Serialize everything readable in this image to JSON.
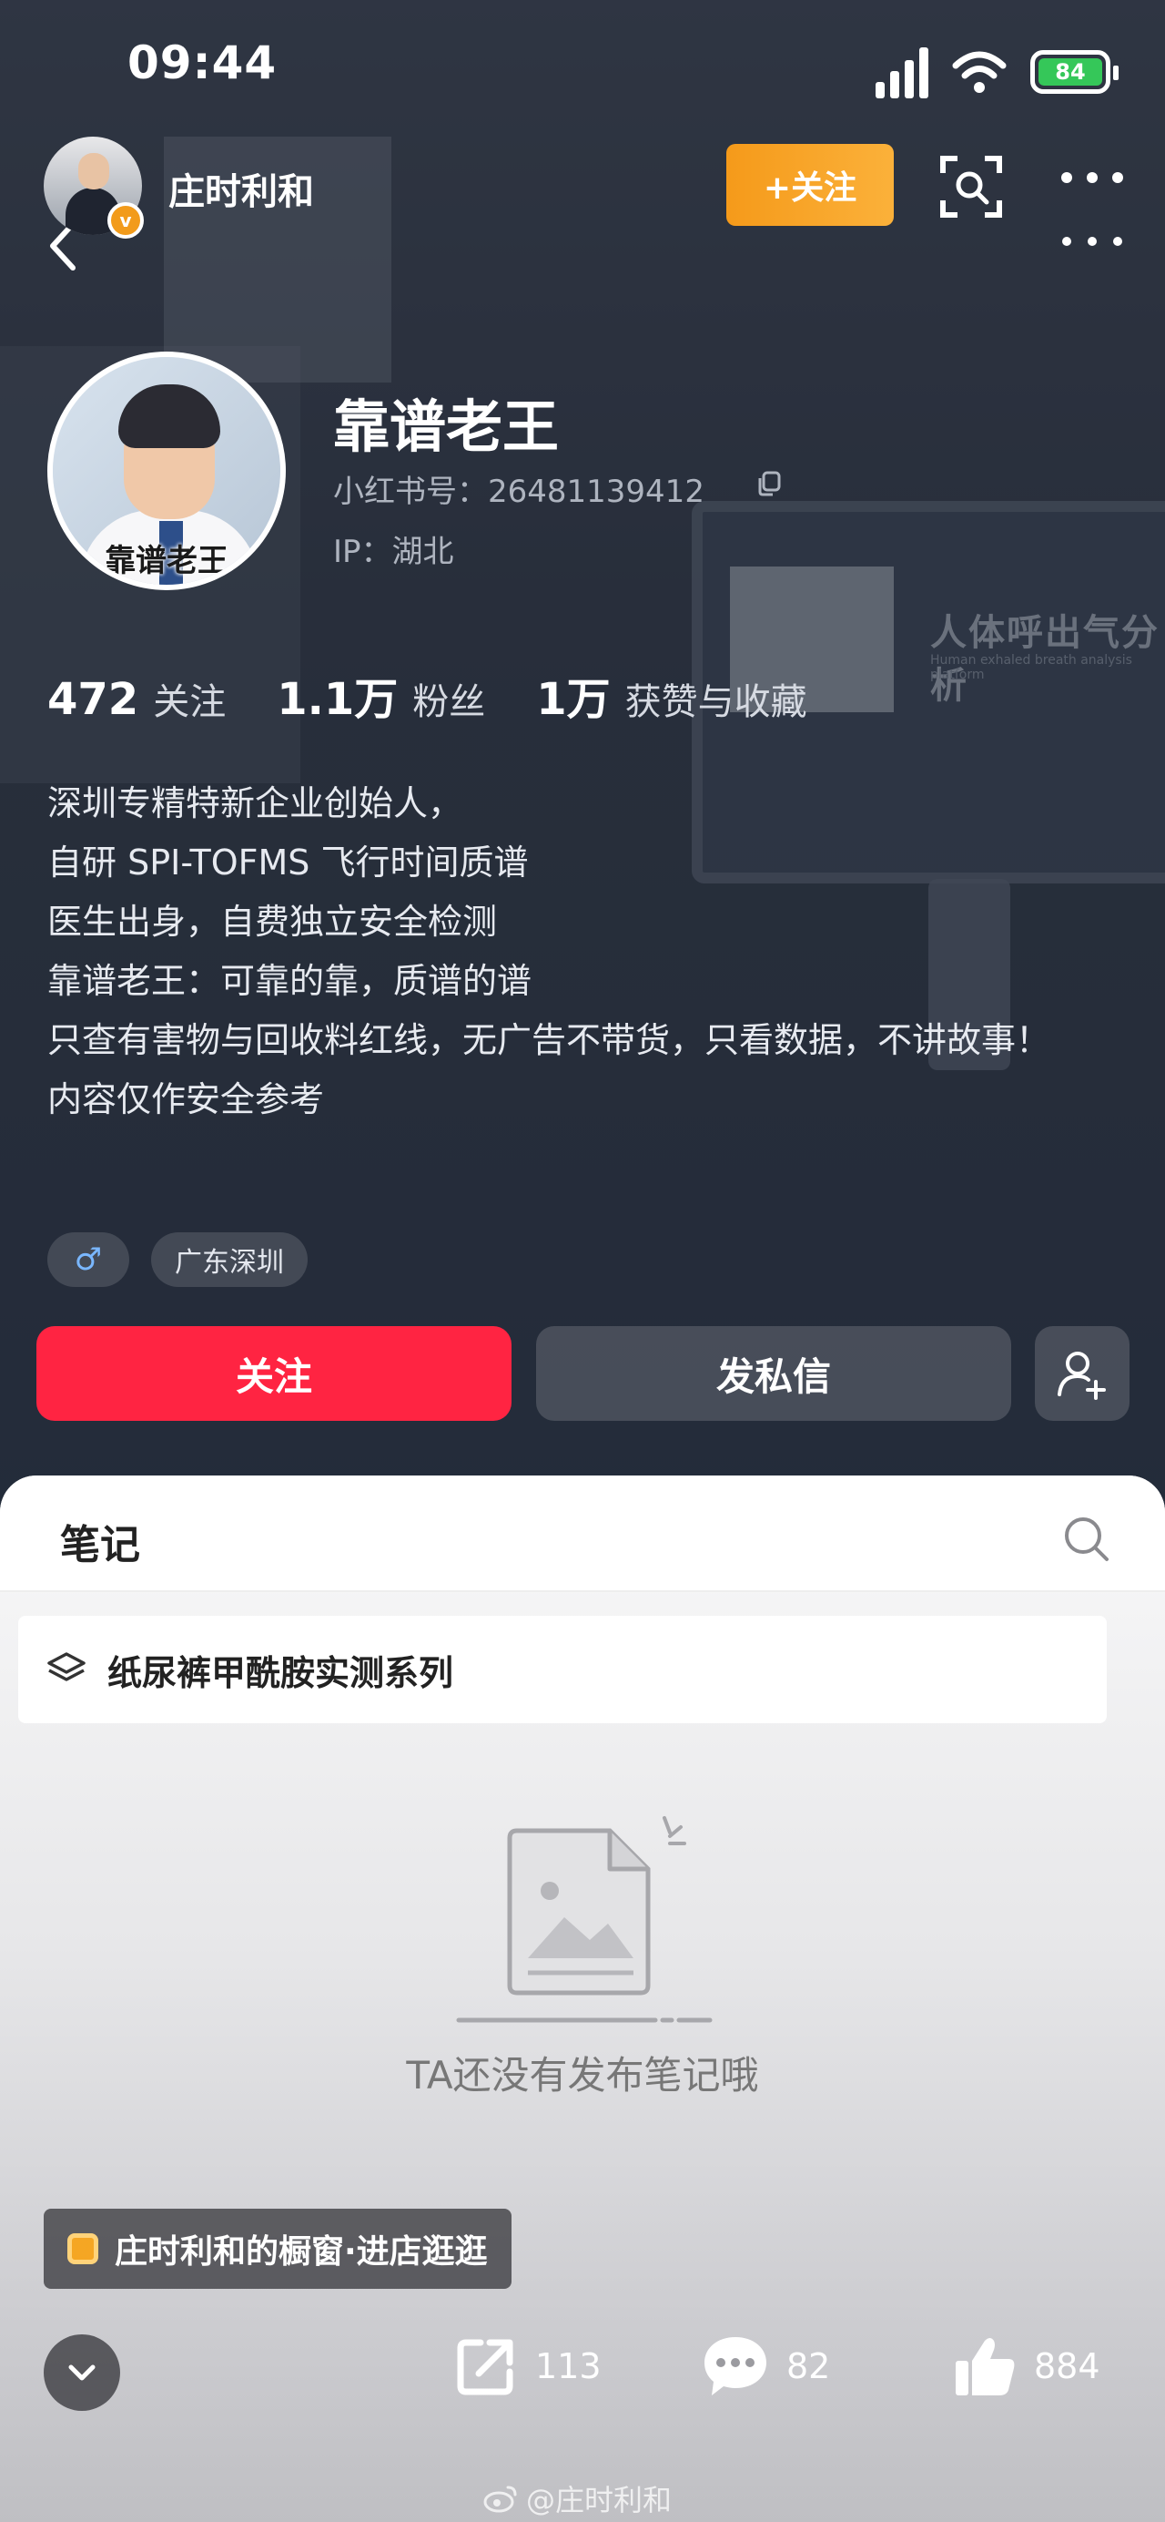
{
  "status_bar": {
    "time": "09:44",
    "battery": "84"
  },
  "header": {
    "account_name": "庄时利和",
    "follow_label": "+关注"
  },
  "profile": {
    "avatar_caption": "靠谱老王",
    "nickname": "靠谱老王",
    "xhs_id": "小红书号：26481139412",
    "ip": "IP：湖北"
  },
  "stats": [
    {
      "value": "472",
      "label": "关注"
    },
    {
      "value": "1.1万",
      "label": "粉丝"
    },
    {
      "value": "1万",
      "label": "获赞与收藏"
    }
  ],
  "bio": [
    "深圳专精特新企业创始人，",
    "自研 SPI-TOFMS 飞行时间质谱",
    "医生出身，自费独立安全检测",
    "靠谱老王：可靠的靠，质谱的谱",
    "只查有害物与回收料红线，无广告不带货，只看数据，不讲故事！",
    "内容仅作安全参考"
  ],
  "tags": {
    "gender": "♂",
    "location": "广东深圳"
  },
  "buttons": {
    "follow": "关注",
    "message": "发私信"
  },
  "notes": {
    "tab_label": "笔记",
    "collection_label": "纸尿裤甲酰胺实测系列",
    "empty_text": "TA还没有发布笔记哦"
  },
  "bottom": {
    "shop_label": "庄时利和的橱窗·进店逛逛",
    "share_count": "113",
    "comment_count": "82",
    "like_count": "884"
  },
  "watermark": "@庄时利和",
  "background_monitor": {
    "title": "人体呼出气分析",
    "subtitle": "Human exhaled breath analysis platform"
  }
}
